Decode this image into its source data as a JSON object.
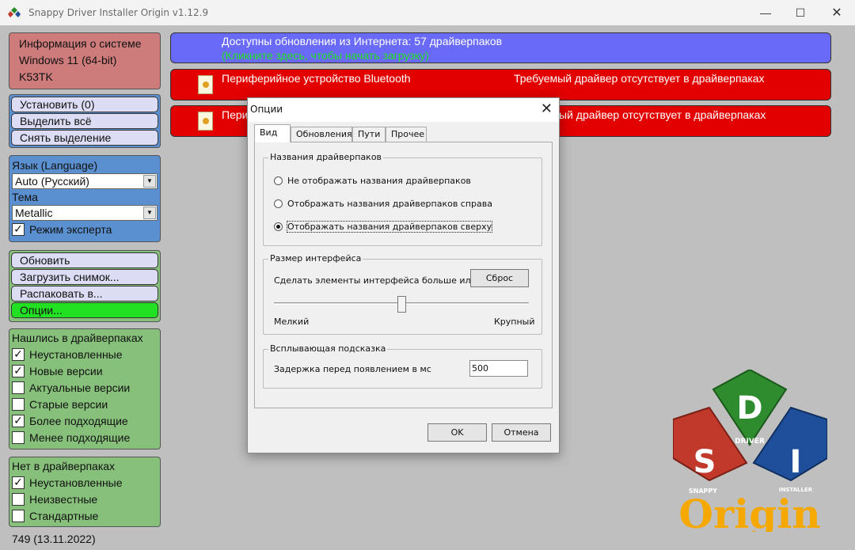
{
  "window": {
    "title": "Snappy Driver Installer Origin v1.12.9",
    "controls": {
      "minimize": "—",
      "maximize": "☐",
      "close": "✕"
    }
  },
  "sidebar": {
    "info": {
      "title": "Информация о системе",
      "os": "Windows 11 (64-bit)",
      "machine": "K53TK"
    },
    "install_buttons": [
      "Установить (0)",
      "Выделить всё",
      "Снять выделение"
    ],
    "language": {
      "label": "Язык (Language)",
      "value": "Auto (Русский)"
    },
    "theme": {
      "label": "Тема",
      "value": "Metallic"
    },
    "expert_mode": {
      "label": "Режим эксперта",
      "checked": true
    },
    "action_buttons": [
      "Обновить",
      "Загрузить снимок...",
      "Распаковать в...",
      "Опции..."
    ],
    "found_group": {
      "title": "Нашлись в драйверпаках",
      "items": [
        {
          "label": "Неустановленные",
          "checked": true
        },
        {
          "label": "Новые версии",
          "checked": true
        },
        {
          "label": "Актуальные версии",
          "checked": false
        },
        {
          "label": "Старые версии",
          "checked": false
        },
        {
          "label": "Более подходящие",
          "checked": true
        },
        {
          "label": "Менее подходящие",
          "checked": false
        }
      ]
    },
    "notfound_group": {
      "title": "Нет в драйверпаках",
      "items": [
        {
          "label": "Неустановленные",
          "checked": true
        },
        {
          "label": "Неизвестные",
          "checked": false
        },
        {
          "label": "Стандартные",
          "checked": false
        }
      ]
    },
    "version": "749 (13.11.2022)"
  },
  "main": {
    "update_row": {
      "line1": "Доступны обновления из Интернета: 57 драйверпаков",
      "line2": "(Кликните здесь, чтобы начать загрузку)"
    },
    "device_rows": [
      {
        "device": "Периферийное устройство Bluetooth",
        "status": "Требуемый драйвер отсутствует в драйверпаках"
      },
      {
        "device": "Пери",
        "status": "ый драйвер отсутствует в драйверпаках"
      }
    ]
  },
  "logo": {
    "s": "S",
    "d": "D",
    "i": "I",
    "snappy": "SNAPPY",
    "driver": "DRIVER",
    "installer": "INSTALLER",
    "origin": "Origin"
  },
  "dialog": {
    "title": "Опции",
    "close": "✕",
    "tabs": [
      "Вид",
      "Обновления",
      "Пути",
      "Прочее"
    ],
    "names_group": {
      "legend": "Названия драйверпаков",
      "options": [
        {
          "label": "Не отображать названия драйверпаков",
          "selected": false
        },
        {
          "label": "Отображать названия драйверпаков справа",
          "selected": false
        },
        {
          "label": "Отображать названия драйверпаков сверху",
          "selected": true
        }
      ]
    },
    "size_group": {
      "legend": "Размер интерфейса",
      "description": "Сделать элементы интерфейса больше или мен",
      "reset_button": "Сброс",
      "min_label": "Мелкий",
      "max_label": "Крупный",
      "slider_position": 0.5
    },
    "tooltip_group": {
      "legend": "Всплывающая подсказка",
      "delay_label": "Задержка перед появлением в мс",
      "delay_value": "500"
    },
    "ok": "OK",
    "cancel": "Отмена"
  }
}
